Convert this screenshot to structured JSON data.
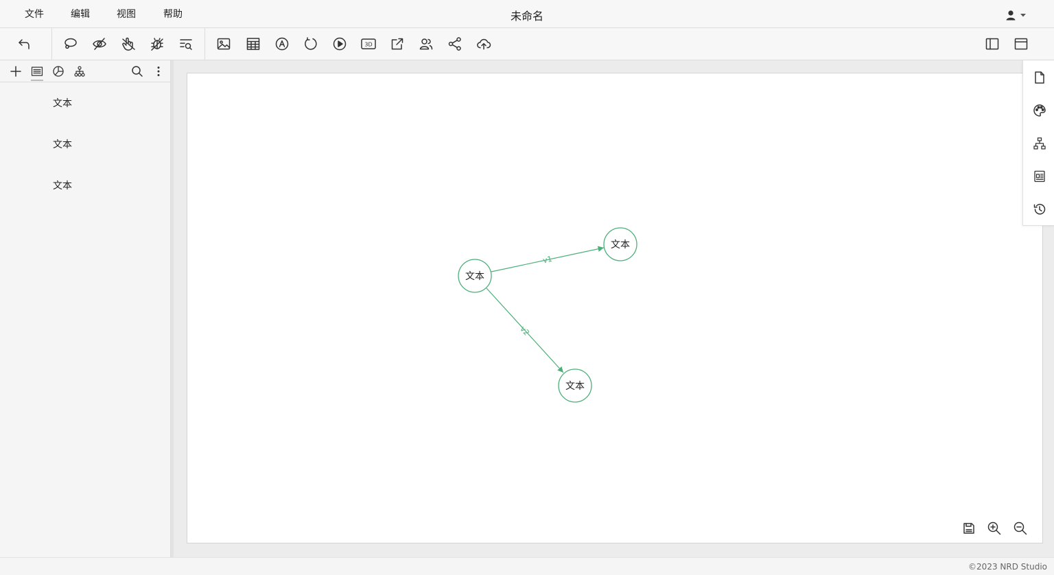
{
  "menu": {
    "items": [
      {
        "id": "file",
        "label": "文件"
      },
      {
        "id": "edit",
        "label": "编辑"
      },
      {
        "id": "view",
        "label": "视图"
      },
      {
        "id": "help",
        "label": "帮助"
      }
    ]
  },
  "document": {
    "title": "未命名"
  },
  "theme": {
    "accent": "#4caf7a",
    "icon": "#333333",
    "canvas_bg": "#ffffff"
  },
  "toolbar": {
    "icons": [
      "undo-icon",
      "lasso-icon",
      "eye-off-icon",
      "hand-pointer-icon",
      "bug-off-icon",
      "filter-search-icon",
      "image-icon",
      "table-icon",
      "auto-text-icon",
      "rotate-icon",
      "play-icon",
      "3d-icon",
      "open-external-icon",
      "users-icon",
      "share-icon",
      "cloud-upload-icon",
      "sidebar-left-icon",
      "window-icon"
    ],
    "threed_label": "3D"
  },
  "left_panel": {
    "tabs": [
      "add-icon",
      "list-icon",
      "pie-chart-icon",
      "hierarchy-icon",
      "search-icon",
      "more-vertical-icon"
    ],
    "active_tab": "list-icon",
    "outline": [
      {
        "label": "文本"
      },
      {
        "label": "文本"
      },
      {
        "label": "文本"
      }
    ]
  },
  "graph": {
    "nodes": [
      {
        "id": "n1",
        "label": "文本"
      },
      {
        "id": "n2",
        "label": "文本"
      },
      {
        "id": "n3",
        "label": "文本"
      }
    ],
    "edges": [
      {
        "from": "n1",
        "to": "n2",
        "label": "v1"
      },
      {
        "from": "n1",
        "to": "n3",
        "label": "v2"
      }
    ]
  },
  "right_dock": {
    "icons": [
      "page-icon",
      "palette-icon",
      "sitemap-icon",
      "form-icon",
      "history-icon"
    ]
  },
  "canvas_controls": {
    "icons": [
      "save-icon",
      "zoom-in-icon",
      "zoom-out-icon"
    ]
  },
  "footer": {
    "copyright": "©2023 NRD Studio"
  }
}
